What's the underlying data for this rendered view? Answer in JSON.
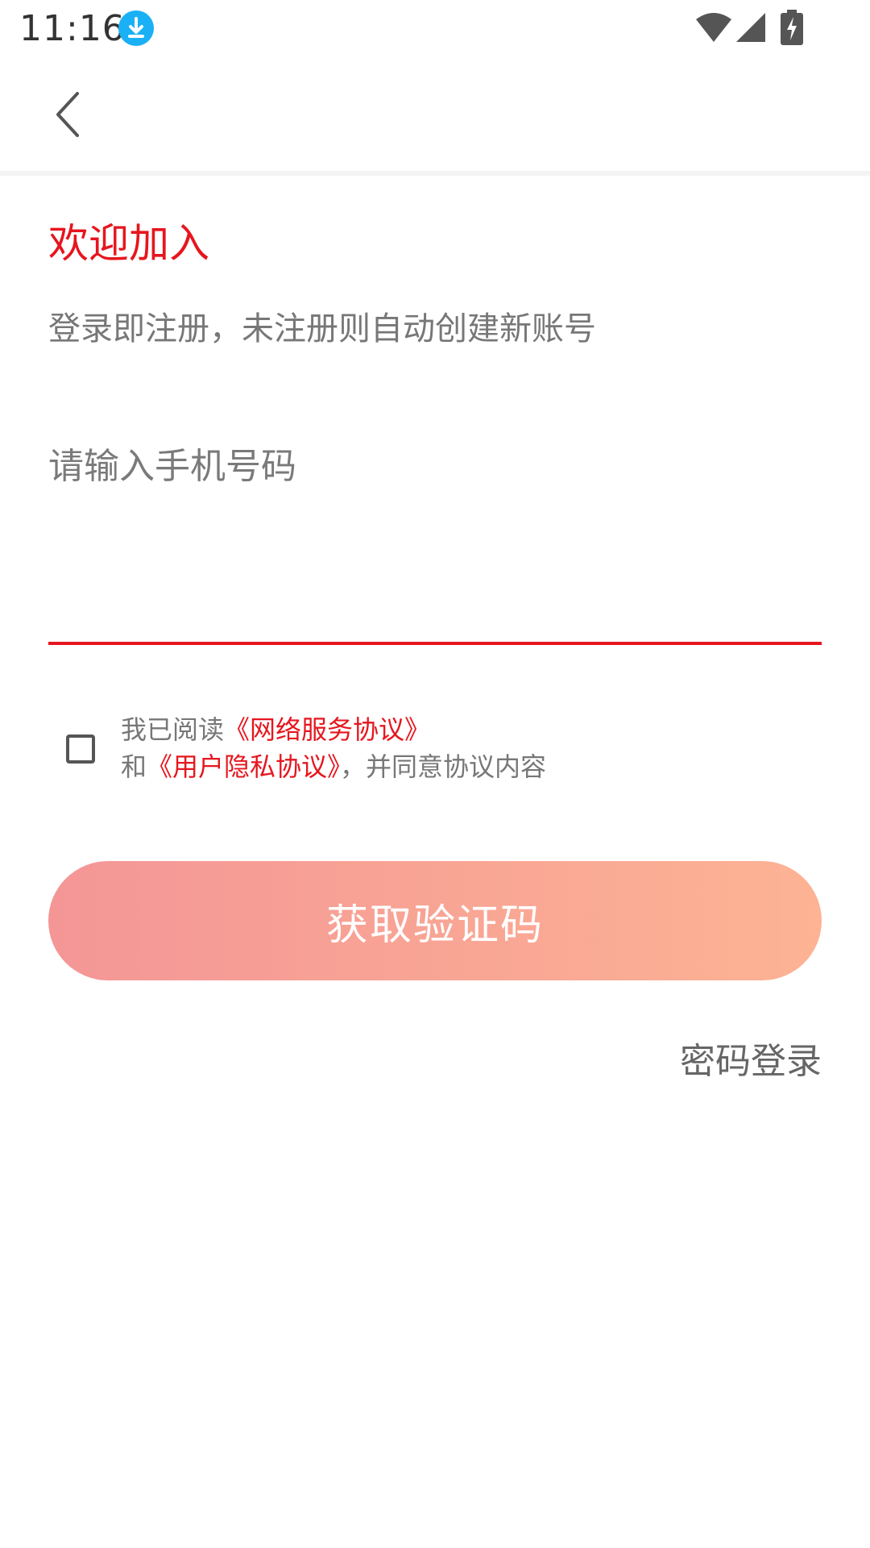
{
  "status_bar": {
    "time": "11:16",
    "icons": [
      "download-icon",
      "wifi-icon",
      "signal-icon",
      "battery-charging-icon"
    ]
  },
  "header": {
    "back_icon": "chevron-left-icon"
  },
  "welcome": {
    "title": "欢迎加入",
    "subtitle": "登录即注册，未注册则自动创建新账号"
  },
  "phone": {
    "placeholder": "请输入手机号码",
    "value": ""
  },
  "agreement": {
    "checked": false,
    "line1_prefix": "我已阅读",
    "service_link": "《网络服务协议》",
    "line2_prefix": "和",
    "privacy_link": "《用户隐私协议》",
    "line2_suffix": "，并同意协议内容"
  },
  "actions": {
    "get_code_label": "获取验证码",
    "password_login_label": "密码登录"
  },
  "colors": {
    "accent": "#e6161e",
    "button_gradient_start": "#f49696",
    "button_gradient_end": "#fdb394",
    "download_badge": "#1ab0f5"
  }
}
